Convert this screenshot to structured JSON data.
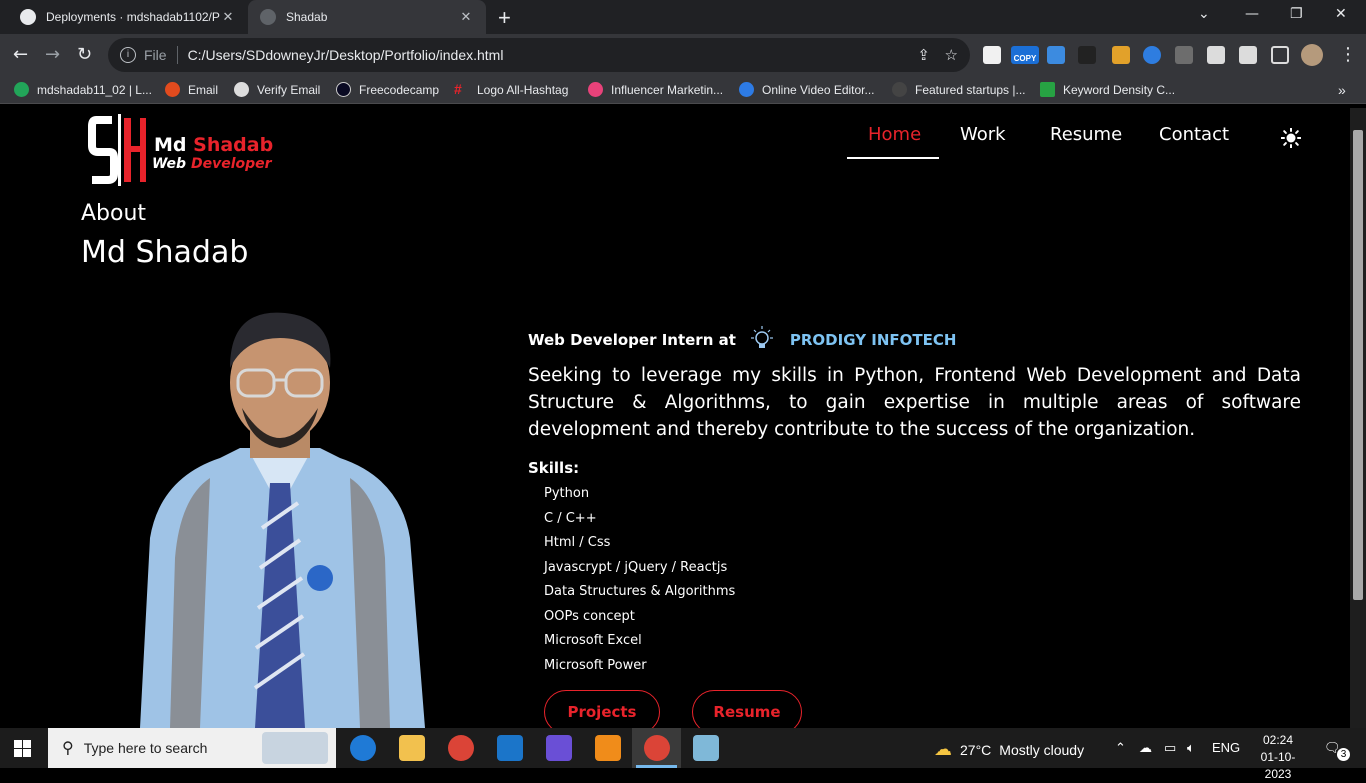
{
  "browser": {
    "tabs": [
      {
        "title": "Deployments · mdshadab1102/P",
        "active": false
      },
      {
        "title": "Shadab",
        "active": true
      }
    ],
    "address": {
      "scheme": "File",
      "url": "C:/Users/SDdowneyJr/Desktop/Portfolio/index.html"
    },
    "bookmarks": [
      {
        "label": "mdshadab11_02 | L...",
        "icon_color": "#22a559"
      },
      {
        "label": "Email",
        "icon_color": "#e24b1e"
      },
      {
        "label": "Verify Email",
        "icon_color": "#dddddd"
      },
      {
        "label": "Freecodecamp",
        "icon_color": "#0a0a23"
      },
      {
        "label": "Logo All-Hashtag",
        "icon_color": "#e8232b"
      },
      {
        "label": "Influencer Marketin...",
        "icon_color": "#e8427a"
      },
      {
        "label": "Online Video Editor...",
        "icon_color": "#2d7be5"
      },
      {
        "label": "Featured startups |...",
        "icon_color": "#444444"
      },
      {
        "label": "Keyword Density C...",
        "icon_color": "#27a243"
      }
    ],
    "copy_ext_label": "COPY"
  },
  "site": {
    "logo": {
      "first": "Md",
      "last": "Shadab",
      "role_a": "Web",
      "role_b": "Developer"
    },
    "nav": [
      {
        "label": "Home",
        "active": true
      },
      {
        "label": "Work",
        "active": false
      },
      {
        "label": "Resume",
        "active": false
      },
      {
        "label": "Contact",
        "active": false
      }
    ],
    "about_label": "About",
    "about_name": "Md Shadab",
    "intern_text": "Web Developer Intern at",
    "company": "PRODIGY INFOTECH",
    "objective": "Seeking to leverage my skills in Python, Frontend Web Development and Data Structure & Algorithms, to gain expertise in multiple areas of software development and thereby contribute to the success of the organization.",
    "skills_title": "Skills:",
    "skills": [
      "Python",
      "C / C++",
      "Html / Css",
      "Javascrypt / jQuery / Reactjs",
      "Data Structures & Algorithms",
      "OOPs concept",
      "Microsoft Excel",
      "Microsoft Power"
    ],
    "buttons": {
      "projects": "Projects",
      "resume": "Resume"
    },
    "accent": "#e8232b",
    "company_color": "#7ec3f2"
  },
  "taskbar": {
    "search_placeholder": "Type here to search",
    "weather": {
      "temp": "27°C",
      "condition": "Mostly cloudy"
    },
    "language": "ENG",
    "time": "02:24",
    "date": "01-10-2023",
    "notifications": "3"
  }
}
